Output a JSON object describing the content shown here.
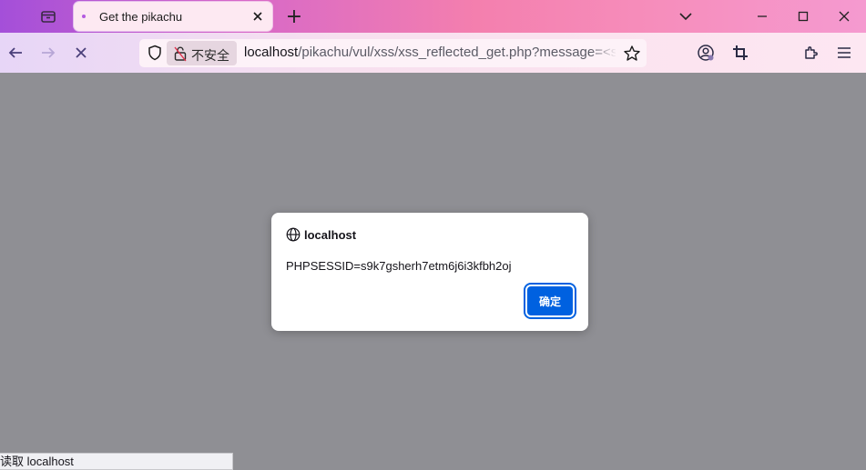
{
  "browser": {
    "tab_title": "Get the pikachu",
    "new_tab_symbol": "+"
  },
  "address_bar": {
    "security_label": "不安全",
    "url_host": "localhost",
    "url_path": "/pikachu/vul/xss/xss_reflected_get.php?message=<sc"
  },
  "dialog": {
    "origin": "localhost",
    "message": "PHPSESSID=s9k7gsherh7etm6j6i3kfbh2oj",
    "ok_label": "确定"
  },
  "status_bar": {
    "text": "读取 localhost"
  },
  "colors": {
    "accent": "#0061e0",
    "overlay": "#8f8f94"
  }
}
